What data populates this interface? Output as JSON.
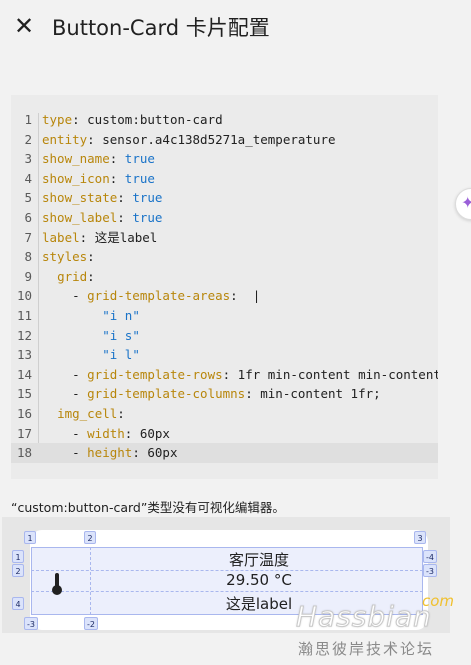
{
  "header": {
    "title": "Button-Card 卡片配置",
    "close_icon": "close-icon"
  },
  "side_handle": {
    "icon": "sparkle-icon"
  },
  "editor": {
    "lines": [
      {
        "n": "1",
        "parts": [
          [
            "k",
            "type"
          ],
          [
            "p",
            ": custom:button-card"
          ]
        ]
      },
      {
        "n": "2",
        "parts": [
          [
            "k",
            "entity"
          ],
          [
            "p",
            ": sensor.a4c138d5271a_temperature"
          ]
        ]
      },
      {
        "n": "3",
        "parts": [
          [
            "k",
            "show_name"
          ],
          [
            "p",
            ": "
          ],
          [
            "b",
            "true"
          ]
        ]
      },
      {
        "n": "4",
        "parts": [
          [
            "k",
            "show_icon"
          ],
          [
            "p",
            ": "
          ],
          [
            "b",
            "true"
          ]
        ]
      },
      {
        "n": "5",
        "parts": [
          [
            "k",
            "show_state"
          ],
          [
            "p",
            ": "
          ],
          [
            "b",
            "true"
          ]
        ]
      },
      {
        "n": "6",
        "parts": [
          [
            "k",
            "show_label"
          ],
          [
            "p",
            ": "
          ],
          [
            "b",
            "true"
          ]
        ]
      },
      {
        "n": "7",
        "parts": [
          [
            "k",
            "label"
          ],
          [
            "p",
            ": 这是label"
          ]
        ]
      },
      {
        "n": "8",
        "parts": [
          [
            "k",
            "styles"
          ],
          [
            "p",
            ":"
          ]
        ]
      },
      {
        "n": "9",
        "parts": [
          [
            "p",
            "  "
          ],
          [
            "k",
            "grid"
          ],
          [
            "p",
            ":"
          ]
        ]
      },
      {
        "n": "10",
        "parts": [
          [
            "p",
            "    - "
          ],
          [
            "k",
            "grid-template-areas"
          ],
          [
            "p",
            ":  |"
          ]
        ]
      },
      {
        "n": "11",
        "parts": [
          [
            "p",
            "        "
          ],
          [
            "s",
            "\"i n\""
          ]
        ]
      },
      {
        "n": "12",
        "parts": [
          [
            "p",
            "        "
          ],
          [
            "s",
            "\"i s\""
          ]
        ]
      },
      {
        "n": "13",
        "parts": [
          [
            "p",
            "        "
          ],
          [
            "s",
            "\"i l\""
          ]
        ]
      },
      {
        "n": "14",
        "parts": [
          [
            "p",
            "    - "
          ],
          [
            "k",
            "grid-template-rows"
          ],
          [
            "p",
            ": 1fr min-content min-content"
          ]
        ]
      },
      {
        "n": "15",
        "parts": [
          [
            "p",
            "    - "
          ],
          [
            "k",
            "grid-template-columns"
          ],
          [
            "p",
            ": min-content 1fr;"
          ]
        ]
      },
      {
        "n": "16",
        "parts": [
          [
            "p",
            "  "
          ],
          [
            "k",
            "img_cell"
          ],
          [
            "p",
            ":"
          ]
        ]
      },
      {
        "n": "17",
        "parts": [
          [
            "p",
            "    - "
          ],
          [
            "k",
            "width"
          ],
          [
            "p",
            ": 60px"
          ]
        ]
      },
      {
        "n": "18",
        "parts": [
          [
            "p",
            "    - "
          ],
          [
            "k",
            "height"
          ],
          [
            "p",
            ": 60px"
          ]
        ]
      }
    ],
    "active_line": "18",
    "colors": {
      "key": "#b8860b",
      "value": "#1a73c8"
    }
  },
  "notice": "“custom:button-card”类型没有可视化编辑器。",
  "preview": {
    "name": "客厅温度",
    "state": "29.50 °C",
    "label": "这是label",
    "icon": "thermometer-icon",
    "grid_tags": {
      "top": [
        "1",
        "2",
        "3"
      ],
      "left": [
        "1",
        "2",
        "4"
      ],
      "right": [
        "-4",
        "-3"
      ],
      "bottom": [
        "-3",
        "-2"
      ]
    }
  },
  "watermark": {
    "brand": "Hassbian",
    "domain": "com",
    "forum": "瀚思彼岸技术论坛"
  }
}
